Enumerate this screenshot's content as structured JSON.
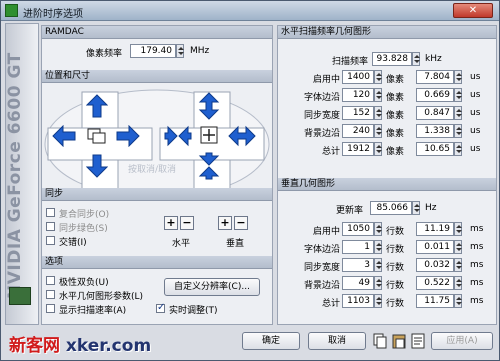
{
  "window": {
    "title": "进阶时序选项",
    "close": "✕"
  },
  "side": {
    "gpu_text": "NVIDIA GeForce 6600 GT"
  },
  "ramdac": {
    "header": "RAMDAC",
    "pixel_clock_label": "像素频率",
    "pixel_clock_value": "179.40",
    "unit": "MHz"
  },
  "pos_size": {
    "header": "位置和尺寸",
    "hint": "按取消/取消"
  },
  "sync": {
    "header": "同步",
    "items": [
      {
        "label": "复合同步(O)",
        "checked": false,
        "disabled": true
      },
      {
        "label": "同步绿色(S)",
        "checked": false,
        "disabled": true
      },
      {
        "label": "交错(I)",
        "checked": false,
        "disabled": false
      }
    ],
    "horizontal_label": "水平",
    "vertical_label": "垂直",
    "plus": "+",
    "minus": "−"
  },
  "options": {
    "header": "选项",
    "items": [
      {
        "label": "极性双负(U)",
        "checked": false
      },
      {
        "label": "水平几何图形参数(L)",
        "checked": false
      },
      {
        "label": "显示扫描速率(A)",
        "checked": false
      }
    ],
    "custom_res_button": "自定义分辨率(C)...",
    "realtime_label": "实时调整(T)",
    "realtime_checked": true
  },
  "hgeom": {
    "header": "水平扫描频率几何图形",
    "scan_label": "扫描频率",
    "scan_value": "93.828",
    "scan_unit": "kHz",
    "rows": [
      {
        "label": "启用中",
        "pixels": "1400",
        "pix_unit": "像素",
        "time": "7.804",
        "time_unit": "us"
      },
      {
        "label": "字体边沿",
        "pixels": "120",
        "pix_unit": "像素",
        "time": "0.669",
        "time_unit": "us"
      },
      {
        "label": "同步宽度",
        "pixels": "152",
        "pix_unit": "像素",
        "time": "0.847",
        "time_unit": "us"
      },
      {
        "label": "背景边沿",
        "pixels": "240",
        "pix_unit": "像素",
        "time": "1.338",
        "time_unit": "us"
      },
      {
        "label": "总计",
        "pixels": "1912",
        "pix_unit": "像素",
        "time": "10.65",
        "time_unit": "us"
      }
    ]
  },
  "vgeom": {
    "header": "垂直几何图形",
    "refresh_label": "更新率",
    "refresh_value": "85.066",
    "refresh_unit": "Hz",
    "rows": [
      {
        "label": "启用中",
        "lines": "1050",
        "line_unit": "行数",
        "time": "11.19",
        "time_unit": "ms"
      },
      {
        "label": "字体边沿",
        "lines": "1",
        "line_unit": "行数",
        "time": "0.011",
        "time_unit": "ms"
      },
      {
        "label": "同步宽度",
        "lines": "3",
        "line_unit": "行数",
        "time": "0.032",
        "time_unit": "ms"
      },
      {
        "label": "背景边沿",
        "lines": "49",
        "line_unit": "行数",
        "time": "0.522",
        "time_unit": "ms"
      },
      {
        "label": "总计",
        "lines": "1103",
        "line_unit": "行数",
        "time": "11.75",
        "time_unit": "ms"
      }
    ]
  },
  "footer": {
    "ok": "确定",
    "cancel": "取消",
    "apply": "应用(A)"
  },
  "watermark": {
    "left": "新客网",
    "right": "xker.com"
  }
}
